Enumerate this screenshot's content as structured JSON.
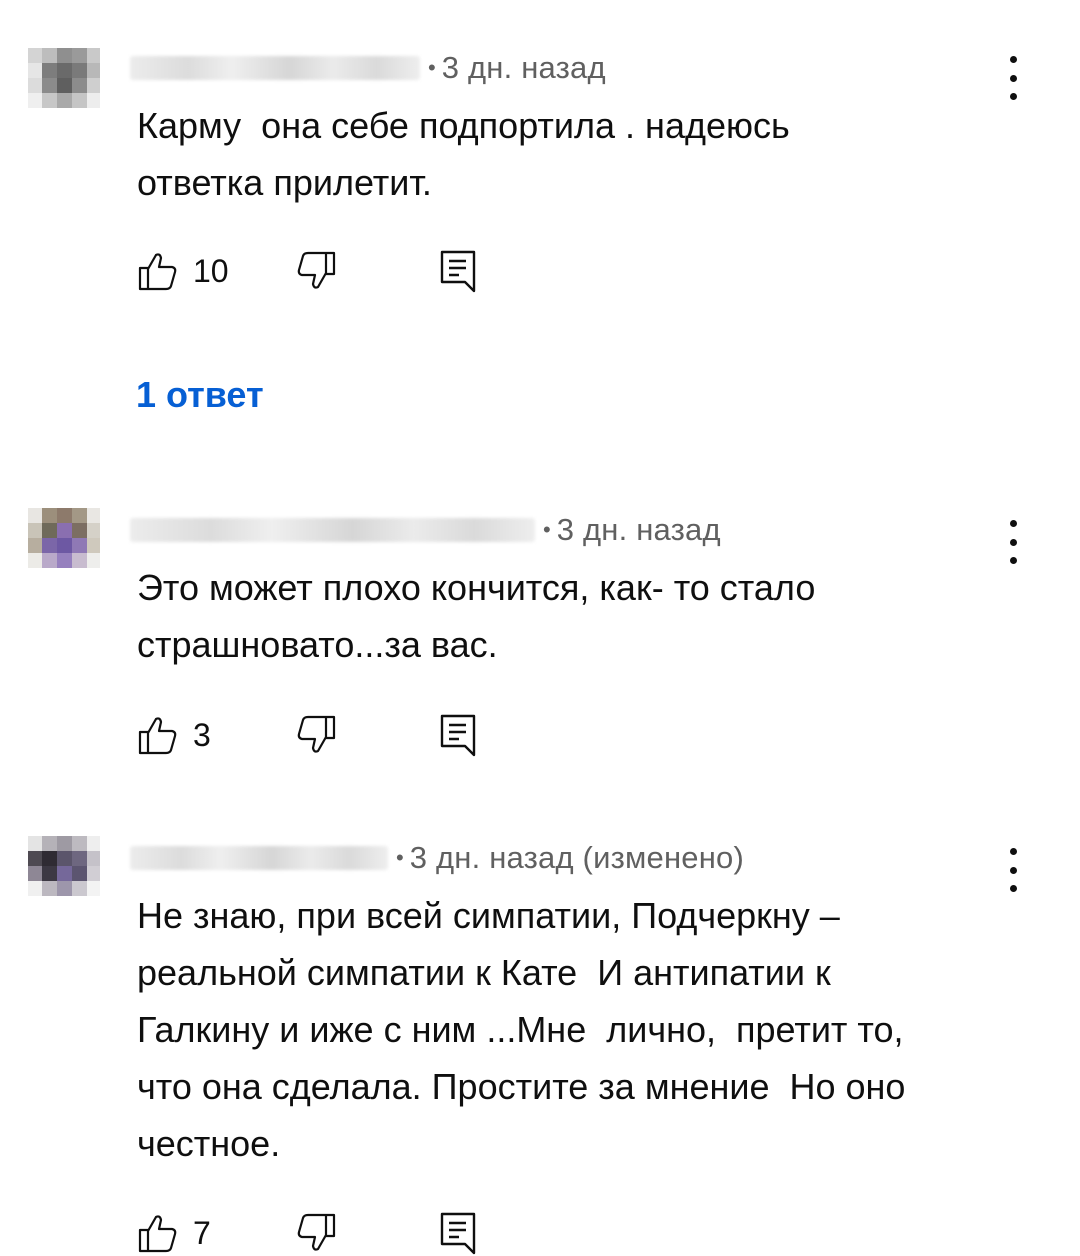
{
  "comments": [
    {
      "time": "3 дн. назад",
      "text": "Карму  она себе подпортила . надеюсь\nответка прилетит.",
      "likes": "10",
      "replies": "1 ответ",
      "avatar_colors": [
        "#d4d4d4",
        "#bdbdbd",
        "#8f8f8f",
        "#9a9a9a",
        "#c9c9c9",
        "#e6e6e6",
        "#7d7d7d",
        "#6a6a6a",
        "#7a7a7a",
        "#b8b8b8",
        "#dcdcdc",
        "#8b8b8b",
        "#5f5f5f",
        "#8c8c8c",
        "#cfcfcf",
        "#efefef",
        "#c7c7c7",
        "#a9a9a9",
        "#c5c5c5",
        "#ededed"
      ]
    },
    {
      "time": "3 дн. назад",
      "text": "Это может плохо кончится, как- то стало\nстрашновато...за вас.",
      "likes": "3",
      "avatar_colors": [
        "#e8e6e2",
        "#9c8f7c",
        "#8d7a6b",
        "#a39886",
        "#e9e7e3",
        "#c9c4b8",
        "#6f6a5a",
        "#8a6fb0",
        "#7c6e62",
        "#d5d1c8",
        "#b7ae9f",
        "#7b66a8",
        "#6d58a3",
        "#8f79b5",
        "#cfc9bd",
        "#ecebe7",
        "#b9a9c9",
        "#9680be",
        "#c8bccf",
        "#eeeeec"
      ]
    },
    {
      "time": "3 дн. назад (изменено)",
      "text": "Не знаю, при всей симпатии, Подчеркну –\nреальной симпатии к Кате  И антипатии к\nГалкину и иже с ним ...Мне  лично,  претит то,\nчто она сделала. Простите за мнение  Но оно\nчестное.",
      "likes": "7",
      "avatar_colors": [
        "#e4e4e4",
        "#b5b2b8",
        "#9e9aa3",
        "#bdbac0",
        "#eeeeee",
        "#4e4a52",
        "#2f2b33",
        "#5b556b",
        "#6e6780",
        "#c5c2c9",
        "#8e8795",
        "#3c3843",
        "#75689a",
        "#5c5570",
        "#d1ced4",
        "#f0f0f0",
        "#bcb8c0",
        "#9d96ab",
        "#cbc8cf",
        "#f3f3f3"
      ]
    }
  ]
}
